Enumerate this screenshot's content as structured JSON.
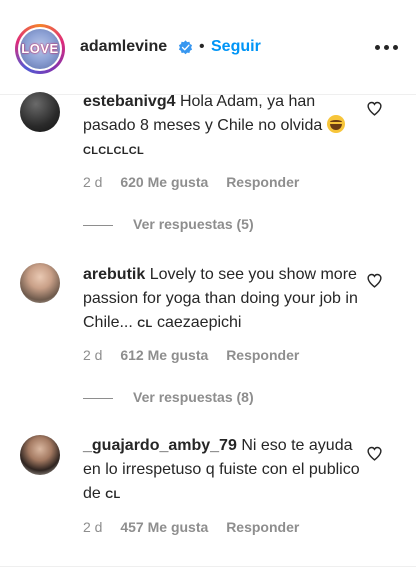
{
  "header": {
    "username": "adamlevine",
    "avatar_text": "LOVE",
    "separator": "•",
    "follow_label": "Seguir"
  },
  "comments": [
    {
      "user": "estebanivg4",
      "text": "Hola Adam, ya han pasado 8 meses y Chile no olvida",
      "flags": "CLCLCLCL",
      "emoji": "grinning-sweat-emoji",
      "time": "2 d",
      "likes": "620 Me gusta",
      "reply_label": "Responder",
      "view_replies": "Ver respuestas (5)"
    },
    {
      "user": "arebutik",
      "text": "Lovely to see you show more passion for yoga than doing your job in Chile...",
      "flags": "CL",
      "text_after": "caezaepichi",
      "time": "2 d",
      "likes": "612 Me gusta",
      "reply_label": "Responder",
      "view_replies": "Ver respuestas (8)"
    },
    {
      "user": "_guajardo_amby_79",
      "text": "Ni eso te ayuda en lo irrespetuso q fuiste con el publico de",
      "flags": "CL",
      "time": "2 d",
      "likes": "457 Me gusta",
      "reply_label": "Responder"
    }
  ],
  "colors": {
    "text": "#262626",
    "muted": "#8e8e8e",
    "accent": "#0095f6"
  }
}
